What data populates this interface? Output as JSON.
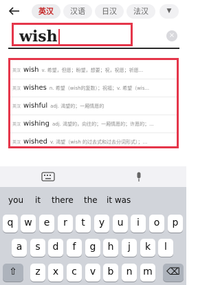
{
  "tabs": [
    {
      "label": "英汉",
      "active": true
    },
    {
      "label": "汉语",
      "active": false
    },
    {
      "label": "日汉",
      "active": false
    },
    {
      "label": "法汉",
      "active": false
    }
  ],
  "more_tabs_icon": "chevron-down-icon",
  "back_icon": "back-arrow-icon",
  "search": {
    "value": "wish",
    "clear_icon": "×"
  },
  "suggestions": [
    {
      "badge": "英汉",
      "word": "wish",
      "definition": "v. 希望，但愿；盼望，想要；祝，祝愿；祈愿..."
    },
    {
      "badge": "英汉",
      "word": "wishes",
      "definition": "n. 希望（wish的复数）；祝福；v. 希望（wis..."
    },
    {
      "badge": "英汉",
      "word": "wishful",
      "definition": "adj. 渴望的；一厢情愿的"
    },
    {
      "badge": "英汉",
      "word": "wishing",
      "definition": "adj. 渴望的，向往的；一厢情愿的；许愿的；..."
    },
    {
      "badge": "英汉",
      "word": "wished",
      "definition": "v. 渴望（wish 的过去式和过去分词形式）；..."
    }
  ],
  "keyboard": {
    "toolbar_icons": [
      "keyboard-icon",
      "microphone-icon"
    ],
    "predictions": [
      "you",
      "it",
      "there",
      "the",
      "it was"
    ],
    "rows": [
      [
        "q",
        "w",
        "e",
        "r",
        "t",
        "y",
        "u",
        "i",
        "o",
        "p"
      ],
      [
        "a",
        "s",
        "d",
        "f",
        "g",
        "h",
        "j",
        "k",
        "l"
      ],
      [
        "z",
        "x",
        "c",
        "v",
        "b",
        "n",
        "m"
      ]
    ],
    "shift_icon": "⇧",
    "delete_icon": "⌫"
  },
  "colors": {
    "highlight": "#e5364a",
    "active_tab": "#c62828"
  }
}
